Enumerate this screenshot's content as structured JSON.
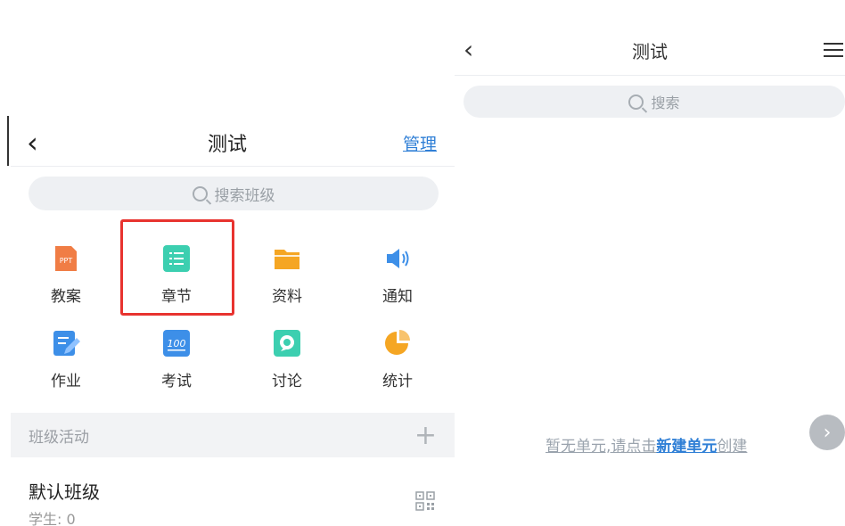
{
  "left": {
    "header": {
      "back_icon": "chevron-left-icon",
      "title": "测试",
      "manage_label": "管理"
    },
    "search": {
      "icon": "search-icon",
      "placeholder": "搜索班级"
    },
    "tools": [
      {
        "label": "教案",
        "icon": "ppt-icon",
        "color": "#f07d45"
      },
      {
        "label": "章节",
        "icon": "chapter-list-icon",
        "color": "#3ccfb0"
      },
      {
        "label": "资料",
        "icon": "folder-icon",
        "color": "#f5a623"
      },
      {
        "label": "通知",
        "icon": "speaker-icon",
        "color": "#3d8fe8"
      },
      {
        "label": "作业",
        "icon": "homework-icon",
        "color": "#3d8fe8"
      },
      {
        "label": "考试",
        "icon": "exam-100-icon",
        "color": "#3d8fe8"
      },
      {
        "label": "讨论",
        "icon": "discussion-icon",
        "color": "#3ccfb0"
      },
      {
        "label": "统计",
        "icon": "pie-chart-icon",
        "color": "#f5a623"
      }
    ],
    "highlight_color": "#e8332f",
    "section": {
      "title": "班级活动",
      "add_icon": "plus-icon"
    },
    "class": {
      "name": "默认班级",
      "students": "学生: 0",
      "qr_icon": "qr-code-icon"
    }
  },
  "right": {
    "header": {
      "back_icon": "chevron-left-icon",
      "title": "测试",
      "menu_icon": "menu-icon"
    },
    "search": {
      "icon": "search-icon",
      "placeholder": "搜索"
    },
    "empty": {
      "prefix": "暂无单元,请点击",
      "link": "新建单元",
      "suffix": "创建"
    },
    "next_icon": "chevron-right-icon"
  },
  "colors": {
    "accent": "#2f7fd6"
  }
}
